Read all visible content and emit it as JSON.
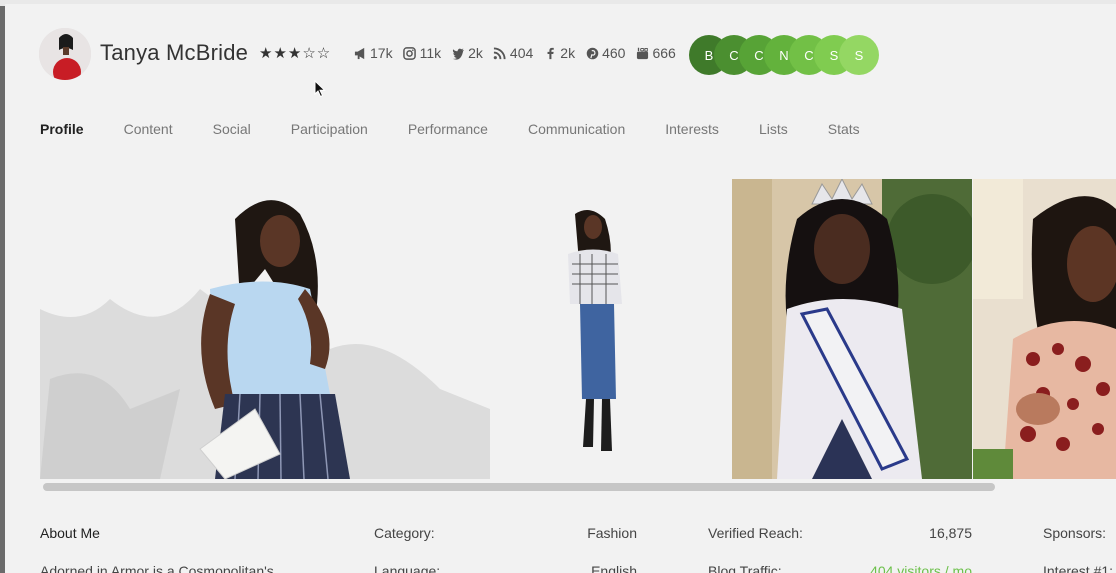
{
  "profile": {
    "name": "Tanya McBride",
    "rating_stars": "★★★☆☆"
  },
  "stats": [
    {
      "icon": "megaphone-icon",
      "value": "17k"
    },
    {
      "icon": "instagram-icon",
      "value": "11k"
    },
    {
      "icon": "twitter-icon",
      "value": "2k"
    },
    {
      "icon": "rss-icon",
      "value": "404"
    },
    {
      "icon": "facebook-icon",
      "value": "2k"
    },
    {
      "icon": "pinterest-icon",
      "value": "460"
    },
    {
      "icon": "youtube-icon",
      "value": "666"
    }
  ],
  "badges": [
    {
      "letter": "B",
      "color": "#3f7a2a"
    },
    {
      "letter": "C",
      "color": "#4b8f30"
    },
    {
      "letter": "C",
      "color": "#57a336"
    },
    {
      "letter": "N",
      "color": "#63b23c"
    },
    {
      "letter": "C",
      "color": "#72c046"
    },
    {
      "letter": "S",
      "color": "#80cc50"
    },
    {
      "letter": "S",
      "color": "#94d763"
    }
  ],
  "tabs": [
    "Profile",
    "Content",
    "Social",
    "Participation",
    "Performance",
    "Communication",
    "Interests",
    "Lists",
    "Stats"
  ],
  "about": {
    "heading": "About Me",
    "text_start": "Adorned in Armor is a Cosmopolitan's"
  },
  "details": {
    "category_label": "Category:",
    "category_value": "Fashion",
    "language_label": "Language:",
    "language_value": "English",
    "verified_reach_label": "Verified Reach:",
    "verified_reach_value": "16,875",
    "blog_traffic_label": "Blog Traffic:",
    "blog_traffic_value": "404 visitors / mo",
    "sponsors_label": "Sponsors:",
    "interest_label": "Interest #1:"
  },
  "colors": {
    "accent_green": "#6cc04a"
  }
}
